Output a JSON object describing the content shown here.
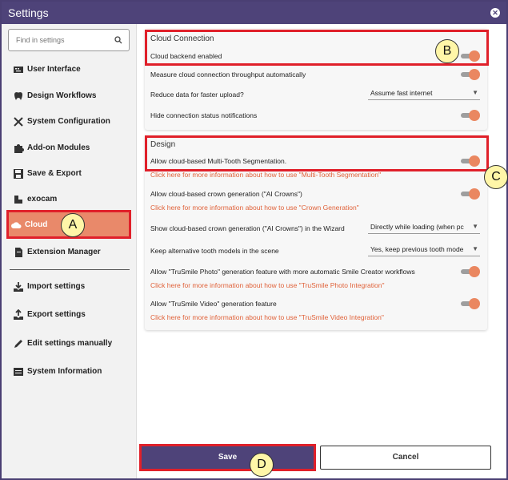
{
  "window": {
    "title": "Settings"
  },
  "sidebar": {
    "search_placeholder": "Find in settings",
    "items": [
      {
        "label": "User Interface",
        "icon": "keyboard-icon"
      },
      {
        "label": "Design Workflows",
        "icon": "tooth-icon"
      },
      {
        "label": "System Configuration",
        "icon": "tools-icon"
      },
      {
        "label": "Add-on Modules",
        "icon": "puzzle-icon"
      },
      {
        "label": "Save & Export",
        "icon": "floppy-icon"
      },
      {
        "label": "exocam",
        "icon": "camera-icon"
      },
      {
        "label": "Cloud",
        "icon": "cloud-icon"
      },
      {
        "label": "Extension Manager",
        "icon": "extension-icon"
      }
    ],
    "bottom_items": [
      {
        "label": "Import settings",
        "icon": "import-icon"
      },
      {
        "label": "Export settings",
        "icon": "export-icon"
      },
      {
        "label": "Edit settings manually",
        "icon": "pencil-icon"
      },
      {
        "label": "System Information",
        "icon": "info-icon"
      }
    ]
  },
  "cloud_connection": {
    "title": "Cloud Connection",
    "backend_label": "Cloud backend enabled",
    "measure_label": "Measure cloud connection throughput automatically",
    "reduce_label": "Reduce data for faster upload?",
    "reduce_value": "Assume fast internet",
    "hide_label": "Hide connection status notifications"
  },
  "design": {
    "title": "Design",
    "multitooth_label": "Allow cloud-based Multi-Tooth Segmentation.",
    "multitooth_link": "Click here for more information about how to use \"Multi-Tooth Segmentation\"",
    "crown_label": "Allow cloud-based crown generation (\"AI Crowns\")",
    "crown_link": "Click here for more information about how to use \"Crown Generation\"",
    "wizard_label": "Show cloud-based crown generation (\"AI Crowns\") in the Wizard",
    "wizard_value": "Directly while loading (when pc",
    "alt_label": "Keep alternative tooth models in the scene",
    "alt_value": "Yes, keep previous tooth mode",
    "photo_label": "Allow \"TruSmile Photo\" generation feature with more automatic Smile Creator workflows",
    "photo_link": "Click here for more information about how to use \"TruSmile Photo Integration\"",
    "video_label": "Allow \"TruSmile Video\" generation feature",
    "video_link": "Click here for more information about how to use \"TruSmile Video Integration\""
  },
  "buttons": {
    "save": "Save",
    "cancel": "Cancel"
  },
  "markers": {
    "a": "A",
    "b": "B",
    "c": "C",
    "d": "D"
  },
  "colors": {
    "accent": "#4e4379",
    "orange": "#e9896a",
    "highlight": "#e0202a",
    "link": "#e0623a"
  }
}
